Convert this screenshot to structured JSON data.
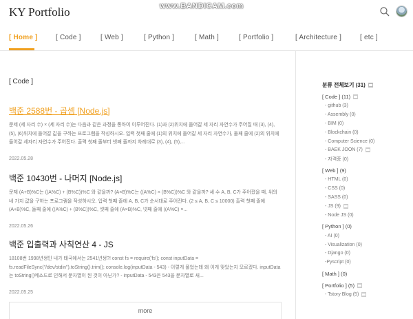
{
  "header": {
    "logo": "KY Portfolio",
    "watermark": "www.BANDICAM.com",
    "search_icon": "search-icon",
    "avatar_icon": "profile-avatar"
  },
  "nav": {
    "items": [
      {
        "label": "[ Home ]",
        "active": true
      },
      {
        "label": "[ Code ]",
        "active": false
      },
      {
        "label": "[ Web ]",
        "active": false
      },
      {
        "label": "[ Python ]",
        "active": false
      },
      {
        "label": "[ Math ]",
        "active": false
      },
      {
        "label": "[ Portfolio ]",
        "active": false
      },
      {
        "label": "[ Architecture ]",
        "active": false
      },
      {
        "label": "[ etc ]",
        "active": false
      }
    ]
  },
  "main": {
    "category_heading": "[ Code ]",
    "posts": [
      {
        "title": "백준 2588번 - 곱셈 [Node.js]",
        "excerpt": "문제 (세 자리 수) × (세 자리 수)는 다음과 같은 과정을 통하여 이루어진다. (1)과 (2)위치에 들어갈 세 자리 자연수가 주어질 때 (3), (4), (5), (6)위치에 들어갈 값을 구하는 프로그램을 작성하시오. 입력 첫째 줄에 (1)의 위치에 들어갈 세 자리 자연수가, 둘째 줄에 (2)의 위치에 들어갈 세자리 자연수가 주어진다. 출력 첫째 줄부터 넷째 줄까지 차례대로 (3), (4), (5),...",
        "date": "2022.05.28"
      },
      {
        "title": "백준 10430번 - 나머지 [Node.js]",
        "excerpt": "문제 (A+B)%C는 ((A%C) + (B%C))%C 와 같을까? (A×B)%C는 ((A%C) × (B%C))%C 와 같을까? 세 수 A, B, C가 주어졌을 때, 위의 네 가지 값을 구하는 프로그램을 작성하시오. 입력 첫째 줄에 A, B, C가 순서대로 주어진다. (2 ≤ A, B, C ≤ 10000) 출력 첫째 줄에 (A+B)%C, 둘째 줄에 ((A%C) + (B%C))%C, 셋째 줄에 (A×B)%C, 넷째 줄에 ((A%C) ×...",
        "date": "2022.05.26"
      },
      {
        "title": "백준 입출력과 사칙연산 4 - JS",
        "excerpt": "18108번 1998년생인 내가 태국에서는 2541년생?! const fs = require('fs'); const inputData = fs.readFileSync(\"/dev/stdin\").toString().trim(); console.log(inputData - 543) - 이렇게 풀었는데 왜 이게 맞았는지 모르겠다. inputData는 toString()메소드로 인해서 문자열이 된 것이 아닌가? - inputData - 543은 543을 문자열로 새...",
        "date": "2022.05.25"
      }
    ],
    "more_label": "more"
  },
  "sidebar": {
    "title": "분류 전체보기 (31)",
    "sections": [
      {
        "label": "[ Code ] (11)",
        "icon": true,
        "items": [
          {
            "label": "- github (3)",
            "icon": false
          },
          {
            "label": "- Assembly (0)",
            "icon": false
          },
          {
            "label": "- BIM (0)",
            "icon": false
          },
          {
            "label": "- Blockchain (0)",
            "icon": false
          },
          {
            "label": "- Computer Science (0)",
            "icon": false
          },
          {
            "label": "- BAEK JOON (7)",
            "icon": true
          },
          {
            "label": "- 자격증 (0)",
            "icon": false
          }
        ]
      },
      {
        "label": "[ Web ] (9)",
        "icon": false,
        "items": [
          {
            "label": "- HTML (0)",
            "icon": false
          },
          {
            "label": "- CSS (0)",
            "icon": false
          },
          {
            "label": "- SASS (0)",
            "icon": false
          },
          {
            "label": "- JS (9)",
            "icon": true
          },
          {
            "label": "- Node JS (0)",
            "icon": false
          }
        ]
      },
      {
        "label": "[ Python ] (0)",
        "icon": false,
        "items": [
          {
            "label": "- AI (0)",
            "icon": false
          },
          {
            "label": "- Visualization (0)",
            "icon": false
          },
          {
            "label": "- Django (0)",
            "icon": false
          },
          {
            "label": "-Pyscript (0)",
            "icon": false
          }
        ]
      },
      {
        "label": "[ Math ] (0)",
        "icon": false,
        "items": []
      },
      {
        "label": "[ Portfolio ] (5)",
        "icon": true,
        "items": [
          {
            "label": "- Tstory Blog (5)",
            "icon": true
          }
        ]
      }
    ]
  },
  "colors": {
    "accent": "#f0a020",
    "text": "#333333",
    "muted": "#777777",
    "border": "#e6e6e6"
  }
}
